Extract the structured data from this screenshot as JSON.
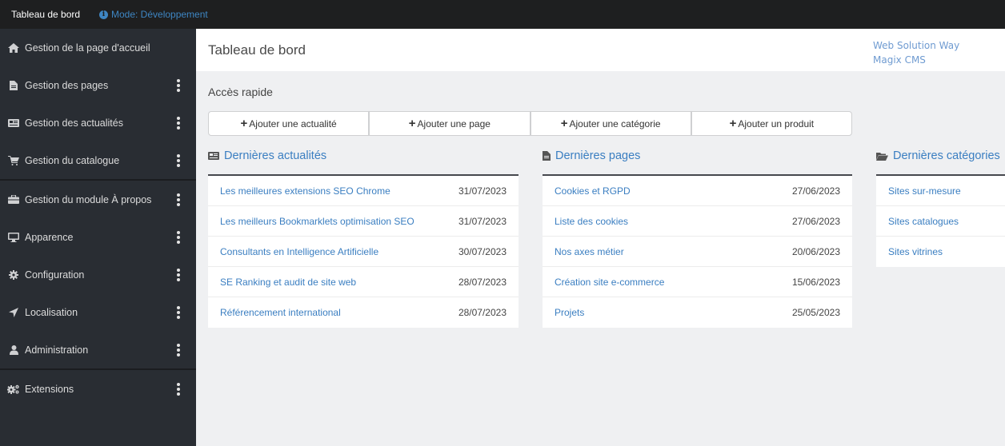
{
  "topbar": {
    "title": "Tableau de bord",
    "mode": "Mode: Développement"
  },
  "sidebar": {
    "items": [
      {
        "label": "Gestion de la page d'accueil",
        "icon": "home-icon",
        "menu": false
      },
      {
        "label": "Gestion des pages",
        "icon": "file-icon",
        "menu": true
      },
      {
        "label": "Gestion des actualités",
        "icon": "newspaper-icon",
        "menu": true
      },
      {
        "label": "Gestion du catalogue",
        "icon": "cart-icon",
        "menu": true
      },
      {
        "label": "Gestion du module À propos",
        "icon": "briefcase-icon",
        "menu": true
      },
      {
        "label": "Apparence",
        "icon": "desktop-icon",
        "menu": true
      },
      {
        "label": "Configuration",
        "icon": "gear-icon",
        "menu": true
      },
      {
        "label": "Localisation",
        "icon": "location-arrow-icon",
        "menu": true
      },
      {
        "label": "Administration",
        "icon": "user-icon",
        "menu": true
      },
      {
        "label": "Extensions",
        "icon": "gears-icon",
        "menu": true
      }
    ]
  },
  "header": {
    "title": "Tableau de bord",
    "brand_line1": "Web Solution Way",
    "brand_line2": "Magix CMS"
  },
  "quick_access": {
    "title": "Accès rapide",
    "buttons": [
      "Ajouter une actualité",
      "Ajouter une page",
      "Ajouter une catégorie",
      "Ajouter un produit"
    ]
  },
  "panels": {
    "news": {
      "title": "Dernières actualités",
      "rows": [
        {
          "title": "Les meilleures extensions SEO Chrome",
          "date": "31/07/2023"
        },
        {
          "title": "Les meilleurs Bookmarklets optimisation SEO",
          "date": "31/07/2023"
        },
        {
          "title": "Consultants en Intelligence Artificielle",
          "date": "30/07/2023"
        },
        {
          "title": "SE Ranking et audit de site web",
          "date": "28/07/2023"
        },
        {
          "title": "Référencement international",
          "date": "28/07/2023"
        }
      ]
    },
    "pages": {
      "title": "Dernières pages",
      "rows": [
        {
          "title": "Cookies et RGPD",
          "date": "27/06/2023"
        },
        {
          "title": "Liste des cookies",
          "date": "27/06/2023"
        },
        {
          "title": "Nos axes métier",
          "date": "20/06/2023"
        },
        {
          "title": "Création site e-commerce",
          "date": "15/06/2023"
        },
        {
          "title": "Projets",
          "date": "25/05/2023"
        }
      ]
    },
    "categories": {
      "title": "Dernières catégories",
      "rows": [
        {
          "title": "Sites sur-mesure"
        },
        {
          "title": "Sites catalogues"
        },
        {
          "title": "Sites vitrines"
        }
      ]
    }
  }
}
